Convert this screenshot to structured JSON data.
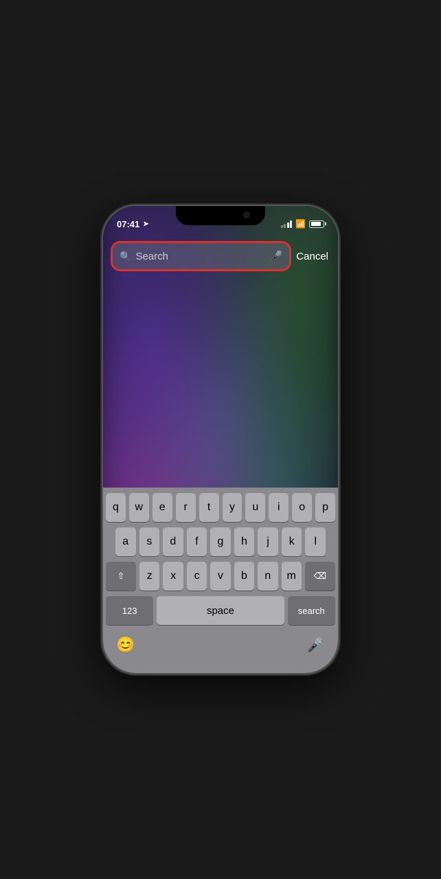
{
  "statusBar": {
    "time": "07:41",
    "locationArrow": "➤"
  },
  "searchBar": {
    "placeholder": "Search",
    "cancelLabel": "Cancel"
  },
  "keyboard": {
    "row1": [
      "q",
      "w",
      "e",
      "r",
      "t",
      "y",
      "u",
      "i",
      "o",
      "p"
    ],
    "row2": [
      "a",
      "s",
      "d",
      "f",
      "g",
      "h",
      "j",
      "k",
      "l"
    ],
    "row3": [
      "z",
      "x",
      "c",
      "v",
      "b",
      "n",
      "m"
    ],
    "numberLabel": "123",
    "spaceLabel": "space",
    "searchLabel": "search",
    "deleteLabel": "⌫",
    "shiftLabel": "⇧"
  }
}
